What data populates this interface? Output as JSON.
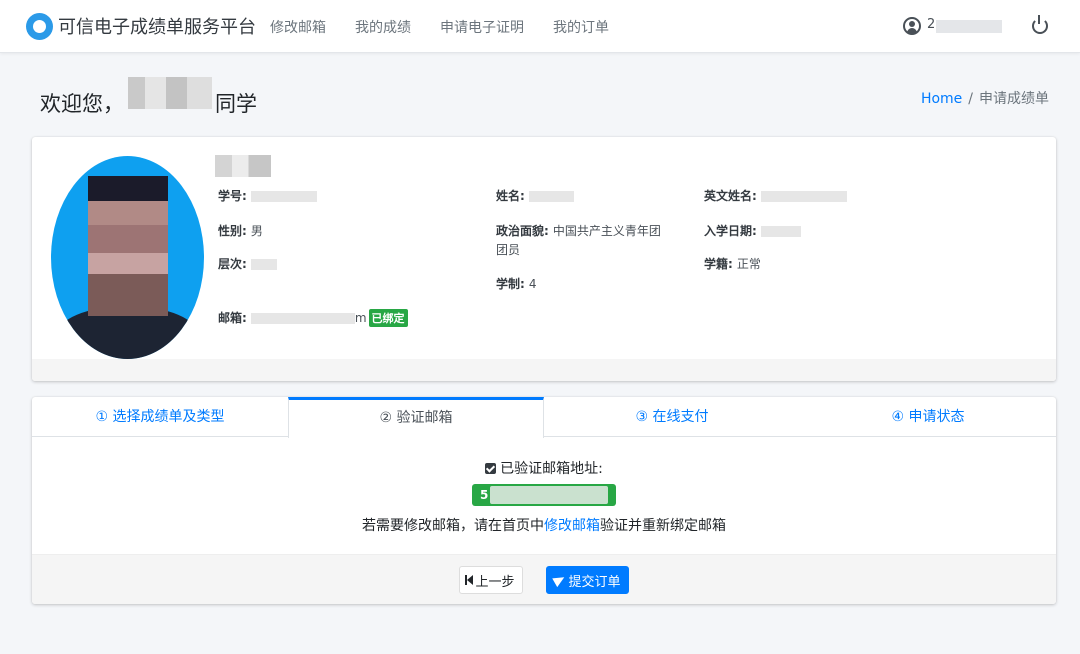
{
  "nav": {
    "brand": "可信电子成绩单服务平台",
    "links": [
      "修改邮箱",
      "我的成绩",
      "申请电子证明",
      "我的订单"
    ],
    "user_prefix": "2"
  },
  "header": {
    "welcome_prefix": "欢迎您，",
    "welcome_suffix": "同学",
    "breadcrumb_home": "Home",
    "breadcrumb_sep": "/",
    "breadcrumb_current": "申请成绩单"
  },
  "profile": {
    "student_id_label": "学号:",
    "gender_label": "性别:",
    "gender_value": "男",
    "level_label": "层次:",
    "email_label": "邮箱:",
    "email_tail": "m",
    "email_badge": "已绑定",
    "name_label": "姓名:",
    "political_label": "政治面貌:",
    "political_value_line1": "中国共产主义青年团",
    "political_value_line2": "团员",
    "duration_label": "学制:",
    "duration_value": "4",
    "english_name_label": "英文姓名:",
    "enroll_date_label": "入学日期:",
    "status_label": "学籍:",
    "status_value": "正常"
  },
  "steps": {
    "tabs": [
      "① 选择成绩单及类型",
      "② 验证邮箱",
      "③ 在线支付",
      "④ 申请状态"
    ],
    "active_index": 1,
    "verified_label": "已验证邮箱地址:",
    "email_prefix": "5",
    "hint_before": "若需要修改邮箱，请在首页中",
    "hint_link": "修改邮箱",
    "hint_after": "验证并重新绑定邮箱",
    "prev_label": "上一步",
    "submit_label": "提交订单"
  }
}
